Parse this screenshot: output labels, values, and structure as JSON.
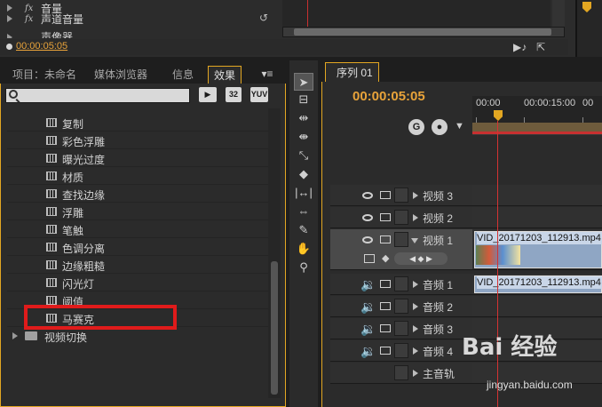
{
  "effect_controls": {
    "rows": [
      "音量",
      "声道音量",
      "声像器"
    ],
    "timecode": "00:00:05:05"
  },
  "effects_panel": {
    "tabs": [
      "项目：未命名",
      "媒体浏览器",
      "信息",
      "效果"
    ],
    "menu_symbol": "▾≡",
    "search_placeholder": "",
    "buttons": [
      "32",
      "YUV"
    ],
    "items": [
      "复制",
      "彩色浮雕",
      "曝光过度",
      "材质",
      "查找边缘",
      "浮雕",
      "笔触",
      "色调分离",
      "边缘粗糙",
      "闪光灯",
      "阈值",
      "马赛克"
    ],
    "folder": "视频切换",
    "highlighted_item": "马赛克"
  },
  "sequence": {
    "tab": "序列 01",
    "timecode": "00:00:05:05",
    "ruler": [
      "00:00",
      "00:00:15:00",
      "00"
    ],
    "tracks": [
      {
        "label": "视频 3",
        "kind": "video"
      },
      {
        "label": "视频 2",
        "kind": "video"
      },
      {
        "label": "视频 1",
        "kind": "video"
      },
      {
        "label": "音频 1",
        "kind": "audio"
      },
      {
        "label": "音频 2",
        "kind": "audio"
      },
      {
        "label": "音频 3",
        "kind": "audio"
      },
      {
        "label": "音频 4",
        "kind": "audio"
      },
      {
        "label": "主音轨",
        "kind": "master"
      }
    ],
    "video_clip": "VID_20171203_112913.mp4",
    "audio_clip": "VID_20171203_112913.mp4"
  },
  "watermark": {
    "text": "Bai 经验",
    "url": "jingyan.baidu.com"
  },
  "colors": {
    "accent": "#e3a722",
    "timecode": "#e8a33a",
    "playhead": "#d43232",
    "highlight": "#e01b1b"
  }
}
